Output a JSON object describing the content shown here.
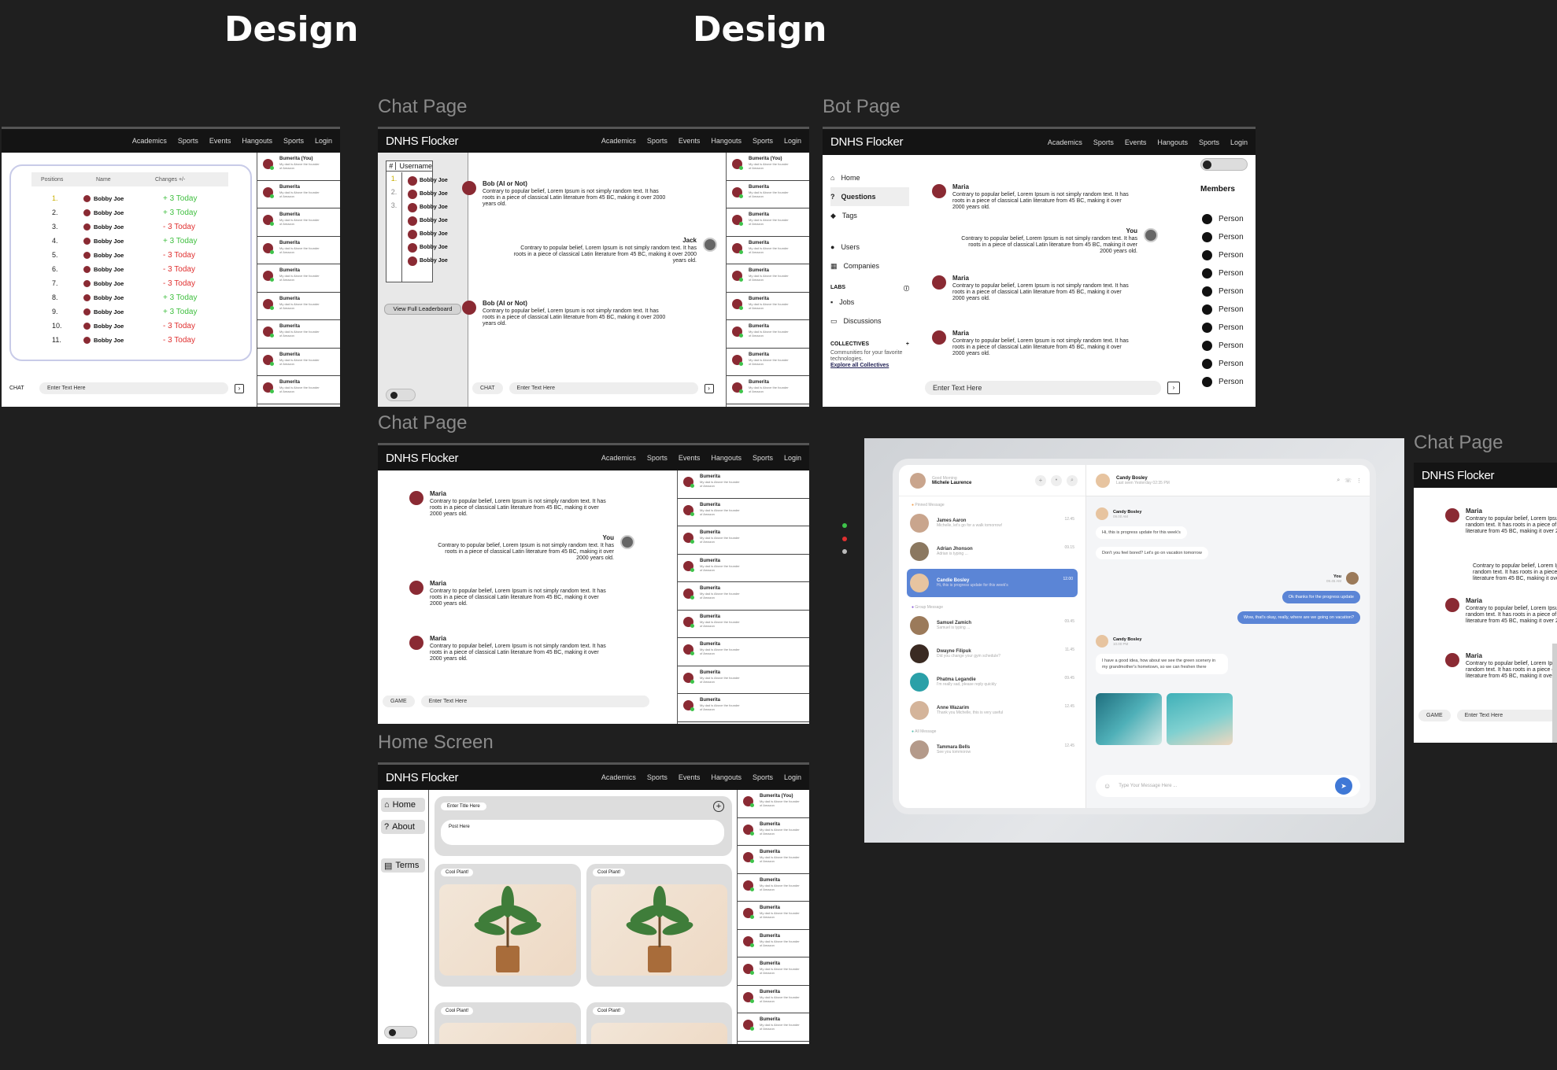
{
  "titles": {
    "design_left": "Design",
    "design_center": "Design"
  },
  "labels": {
    "chat_page_1": "Chat Page",
    "bot_page": "Bot Page",
    "chat_page_2": "Chat Page",
    "home_screen": "Home Screen",
    "chat_page_3": "Chat Page"
  },
  "brand": "DNHS Flocker",
  "nav": [
    "Academics",
    "Sports",
    "Events",
    "Hangouts",
    "Sports",
    "Login"
  ],
  "right_panel": {
    "first_name": "Bumerita (You)",
    "name": "Bumerita",
    "blurb": "My dad is Above the founder of Amazon"
  },
  "leaderboard": {
    "headers": {
      "positions": "Positions",
      "name": "Name",
      "changes": "Changes +/-"
    },
    "rows": [
      {
        "pos": "1.",
        "name": "Bobby Joe",
        "change": "+ 3 Today",
        "up": true
      },
      {
        "pos": "2.",
        "name": "Bobby Joe",
        "change": "+ 3 Today",
        "up": true
      },
      {
        "pos": "3.",
        "name": "Bobby Joe",
        "change": "- 3 Today",
        "up": false
      },
      {
        "pos": "4.",
        "name": "Bobby Joe",
        "change": "+ 3 Today",
        "up": true
      },
      {
        "pos": "5.",
        "name": "Bobby Joe",
        "change": "- 3 Today",
        "up": false
      },
      {
        "pos": "6.",
        "name": "Bobby Joe",
        "change": "- 3 Today",
        "up": false
      },
      {
        "pos": "7.",
        "name": "Bobby Joe",
        "change": "- 3 Today",
        "up": false
      },
      {
        "pos": "8.",
        "name": "Bobby Joe",
        "change": "+ 3 Today",
        "up": true
      },
      {
        "pos": "9.",
        "name": "Bobby Joe",
        "change": "+ 3 Today",
        "up": true
      },
      {
        "pos": "10.",
        "name": "Bobby Joe",
        "change": "- 3 Today",
        "up": false
      },
      {
        "pos": "11.",
        "name": "Bobby Joe",
        "change": "- 3 Today",
        "up": false
      }
    ]
  },
  "mini_leaderboard": {
    "hash": "#",
    "username": "Username",
    "nums": [
      "1.",
      "2.",
      "3."
    ],
    "names": [
      "Bobby Joe",
      "Bobby Joe",
      "Bobby Joe",
      "Bobby Joe",
      "Bobby Joe",
      "Bobby Joe",
      "Bobby Joe"
    ],
    "view_full": "View Full Leaderboard"
  },
  "chat_labels": {
    "chat": "CHAT",
    "game": "GAME",
    "enter_text": "Enter Text Here"
  },
  "lorem": "Contrary to popular belief, Lorem Ipsum is not simply random text. It has roots in a piece of classical Latin literature from 45 BC, making it over 2000 years old.",
  "chat1": {
    "bob": "Bob (AI or Not)",
    "jack": "Jack"
  },
  "chat2": {
    "maria": "Maria",
    "you": "You"
  },
  "bot": {
    "sidebar": [
      "Home",
      "Questions",
      "Tags",
      "Users",
      "Companies"
    ],
    "labs": "LABS",
    "labs_items": [
      "Jobs",
      "Discussions"
    ],
    "collectives": "COLLECTIVES",
    "collectives_text": "Communities for your favorite technologies.",
    "explore": "Explore all Collectives",
    "members": "Members",
    "person": "Person"
  },
  "home": {
    "nav": [
      "Home",
      "About",
      "Terms"
    ],
    "title_placeholder": "Enter Title Here",
    "post_placeholder": "Post Here",
    "card_tag": "Cool Plant!"
  },
  "messenger": {
    "greeting": "Good Morning",
    "user": "Michele Laurence",
    "pinned": "Pinned Message",
    "group": "Group Message",
    "all": "All Message",
    "contacts": [
      {
        "name": "James Aaron",
        "text": "Michelle, let's go for a walk tomorrow!",
        "time": "12.45"
      },
      {
        "name": "Adrian Jhonson",
        "text": "Adrian is typing ...",
        "time": "09.15"
      },
      {
        "name": "Candie Bosley",
        "text": "Hi, this is progress update for this week's",
        "time": "12.00"
      },
      {
        "name": "Samuel Zamich",
        "text": "Samuel is typing ...",
        "time": "09.45"
      },
      {
        "name": "Dwayne Filipuk",
        "text": "Did you change your gym schedule?",
        "time": "11.45"
      },
      {
        "name": "Phatma Legandie",
        "text": "I'm really sad, please reply quickly",
        "time": "09.45"
      },
      {
        "name": "Anne Wazarim",
        "text": "Thank you Michelle, this is very useful",
        "time": "12.45"
      },
      {
        "name": "Tammara Bells",
        "text": "See you tommorow",
        "time": "12.45"
      }
    ],
    "chat_name": "Candy Bosley",
    "last_seen": "Last seen Yesterday 02:35 PM",
    "msg1_name": "Candy Bosley",
    "msg1_time": "09.00 AM",
    "msg1a": "Hi, this is progress update for this week's",
    "msg1b": "Don't you feel bored? Let's go on vacation tomorrow",
    "you": "You",
    "you_time": "09.45 AM",
    "reply1": "Ok thanks for the progress update",
    "reply2": "Wow, that's okay, really, where are we going on vacation?",
    "msg2_name": "Candy Bosley",
    "msg2_time": "10.00 PM",
    "msg2": "I have a good idea, how about we see the green scenery in my grandmother's hometown, so we can freshen there",
    "type_placeholder": "Type Your Message Here ..."
  },
  "colors": {
    "up": "#3fbf3f",
    "down": "#e03030",
    "accent": "#5b85d6",
    "dark": "#141414"
  }
}
